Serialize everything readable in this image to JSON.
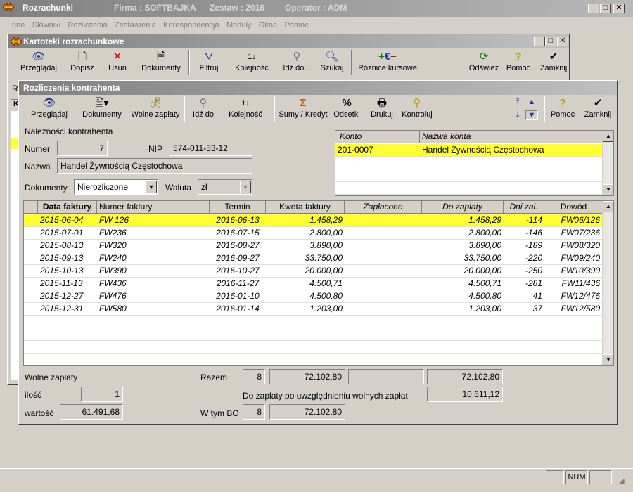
{
  "app": {
    "title": "Rozrachunki",
    "firma": "Firma : SOFTBAJKA",
    "zestaw": "Zestaw : 2016",
    "operator": "Operator : ADM"
  },
  "menu": [
    "Inne",
    "Słowniki",
    "Rozliczenia",
    "Zestawienia",
    "Korespondencja",
    "Moduły",
    "Okna",
    "Pomoc"
  ],
  "kartoteki": {
    "title": "Kartoteki rozrachunkowe",
    "toolbar": {
      "przegladaj": "Przeglądaj",
      "dopisz": "Dopisz",
      "usun": "Usuń",
      "dokumenty": "Dokumenty",
      "filtruj": "Filtruj",
      "kolejnosc": "Kolejność",
      "idz_do": "Idź do...",
      "szukaj": "Szukaj",
      "roznice": "Różnice kursowe",
      "odswiez": "Odśwież",
      "pomoc": "Pomoc",
      "zamknij": "Zamknij"
    }
  },
  "rozliczenia": {
    "title": "Rozliczenia kontrahenta",
    "toolbar": {
      "przegladaj": "Przeglądaj",
      "dokumenty": "Dokumenty",
      "wolne_zaplaty": "Wolne zapłaty",
      "idz_do": "Idź do",
      "kolejnosc": "Kolejność",
      "sumy": "Sumy / Kredyt",
      "odsetki": "Odsetki",
      "drukuj": "Drukuj",
      "kontroluj": "Kontroluj",
      "pomoc": "Pomoc",
      "zamknij": "Zamknij"
    },
    "naleznosci_label": "Należności kontrahenta",
    "numer_label": "Numer",
    "numer": "7",
    "nip_label": "NIP",
    "nip": "574-011-53-12",
    "nazwa_label": "Nazwa",
    "nazwa": "Handel Żywnością Częstochowa",
    "dokumenty_label": "Dokumenty",
    "dokumenty_value": "Nierozliczone",
    "waluta_label": "Waluta",
    "waluta_value": "zł",
    "konto_table": {
      "headers": [
        "Konto",
        "Nazwa konta"
      ],
      "rows": [
        [
          "201-0007",
          "Handel Żywnością Częstochowa"
        ]
      ]
    },
    "invoices": {
      "headers": [
        "Data faktury",
        "Numer  faktury",
        "Termin",
        "Kwota faktury",
        "Zapłacono",
        "Do zapłaty",
        "Dni zal.",
        "Dowód"
      ],
      "rows": [
        [
          "2015-06-04",
          "FW 126",
          "2016-06-13",
          "1.458,29",
          "",
          "1.458,29",
          "-114",
          "FW06/126"
        ],
        [
          "2015-07-01",
          "FW236",
          "2016-07-15",
          "2.800,00",
          "",
          "2.800,00",
          "-146",
          "FW07/236"
        ],
        [
          "2015-08-13",
          "FW320",
          "2016-08-27",
          "3.890,00",
          "",
          "3.890,00",
          "-189",
          "FW08/320"
        ],
        [
          "2015-09-13",
          "FW240",
          "2016-09-27",
          "33.750,00",
          "",
          "33.750,00",
          "-220",
          "FW09/240"
        ],
        [
          "2015-10-13",
          "FW390",
          "2016-10-27",
          "20.000,00",
          "",
          "20.000,00",
          "-250",
          "FW10/390"
        ],
        [
          "2015-11-13",
          "FW436",
          "2016-11-27",
          "4.500,71",
          "",
          "4.500,71",
          "-281",
          "FW11/436"
        ],
        [
          "2015-12-27",
          "FW476",
          "2016-01-10",
          "4.500,80",
          "",
          "4.500,80",
          "41",
          "FW12/476"
        ],
        [
          "2015-12-31",
          "FW580",
          "2016-01-14",
          "1.203,00",
          "",
          "1.203,00",
          "37",
          "FW12/580"
        ]
      ]
    },
    "summary": {
      "wolne_zaplaty_label": "Wolne zapłaty",
      "ilosc_label": "ilość",
      "ilosc": "1",
      "wartosc_label": "wartość",
      "wartosc": "61.491,68",
      "razem_label": "Razem",
      "razem_count": "8",
      "razem_kwota": "72.102,80",
      "razem_zaplacono": "",
      "razem_do_zaplaty": "72.102,80",
      "po_uwzgl_label": "Do zapłaty po uwzględnieniu wolnych zapłat",
      "po_uwzgl_value": "10.611,12",
      "wtym_bo_label": "W tym BO",
      "wtym_bo_count": "8",
      "wtym_bo_kwota": "72.102,80"
    }
  },
  "background_window": {
    "col_label": "R",
    "header_label": "K"
  },
  "status": {
    "num": "NUM"
  }
}
